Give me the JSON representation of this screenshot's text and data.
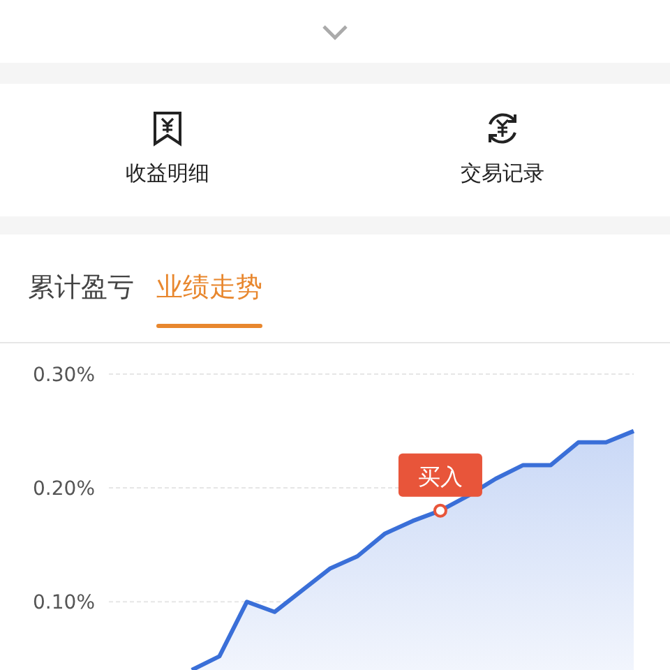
{
  "shortcuts": [
    {
      "label": "收益明细"
    },
    {
      "label": "交易记录"
    }
  ],
  "tabs": [
    {
      "label": "累计盈亏",
      "selected": false
    },
    {
      "label": "业绩走势",
      "selected": true
    }
  ],
  "chart_data": {
    "type": "area",
    "grid": true,
    "ylim": [
      0.04,
      0.3
    ],
    "yticks": [
      {
        "value": 0.1,
        "label": "0.10%"
      },
      {
        "value": 0.2,
        "label": "0.20%"
      },
      {
        "value": 0.3,
        "label": "0.30%"
      }
    ],
    "categories": [
      null,
      null,
      null,
      null,
      null,
      null,
      null,
      null,
      null,
      null,
      null,
      null,
      null,
      null,
      null,
      null,
      null,
      null,
      null,
      null
    ],
    "series": [
      {
        "color": "#3a6fd8",
        "values": [
          null,
          null,
          null,
          0.04,
          0.052,
          0.1,
          0.091,
          0.11,
          0.129,
          0.14,
          0.16,
          0.171,
          0.18,
          0.193,
          0.208,
          0.22,
          0.22,
          0.24,
          0.24,
          0.25
        ]
      }
    ],
    "annotations": [
      {
        "text": "买入",
        "y": 0.18
      }
    ]
  }
}
